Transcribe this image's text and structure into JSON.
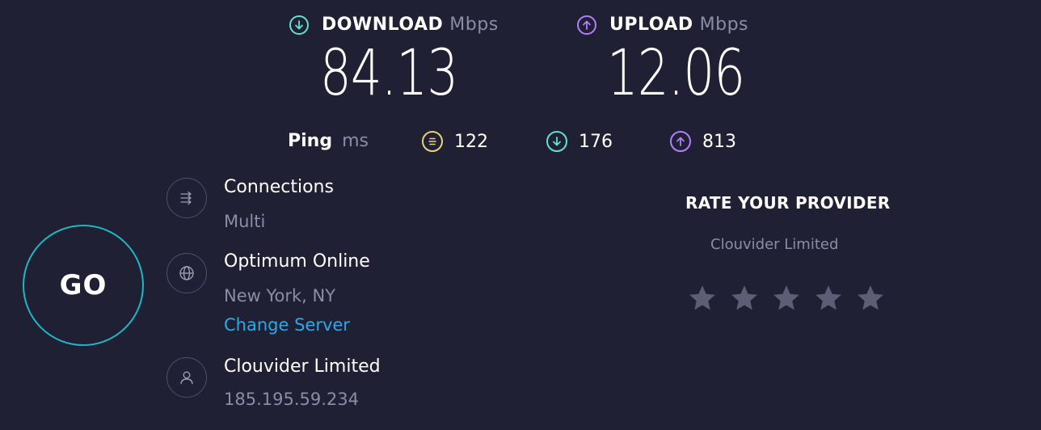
{
  "download": {
    "label": "DOWNLOAD",
    "unit": "Mbps",
    "value": "84.13",
    "icon": "arrow-down-circle-icon",
    "color": "#5fe3cf"
  },
  "upload": {
    "label": "UPLOAD",
    "unit": "Mbps",
    "value": "12.06",
    "icon": "arrow-up-circle-icon",
    "color": "#b57cff"
  },
  "ping": {
    "label": "Ping",
    "unit": "ms",
    "idle": {
      "value": "122",
      "icon": "idle-latency-icon",
      "color": "#e9d176"
    },
    "download": {
      "value": "176",
      "icon": "arrow-down-circle-icon",
      "color": "#5fe3cf"
    },
    "upload": {
      "value": "813",
      "icon": "arrow-up-circle-icon",
      "color": "#b57cff"
    }
  },
  "go_button": {
    "label": "GO",
    "border_color": "#1fb7c4"
  },
  "connections": {
    "title": "Connections",
    "value": "Multi",
    "icon": "connections-icon"
  },
  "server": {
    "title": "Optimum Online",
    "location": "New York, NY",
    "change_label": "Change Server",
    "icon": "globe-icon"
  },
  "provider": {
    "title": "Clouvider Limited",
    "ip": "185.195.59.234",
    "icon": "user-icon"
  },
  "rating": {
    "title": "RATE YOUR PROVIDER",
    "provider_name": "Clouvider Limited",
    "max_stars": 5,
    "selected_stars": 0,
    "star_color": "#5d5e75"
  },
  "colors": {
    "background": "#1f2033",
    "muted_text": "#8b8ca6",
    "link": "#2aa8e8"
  }
}
